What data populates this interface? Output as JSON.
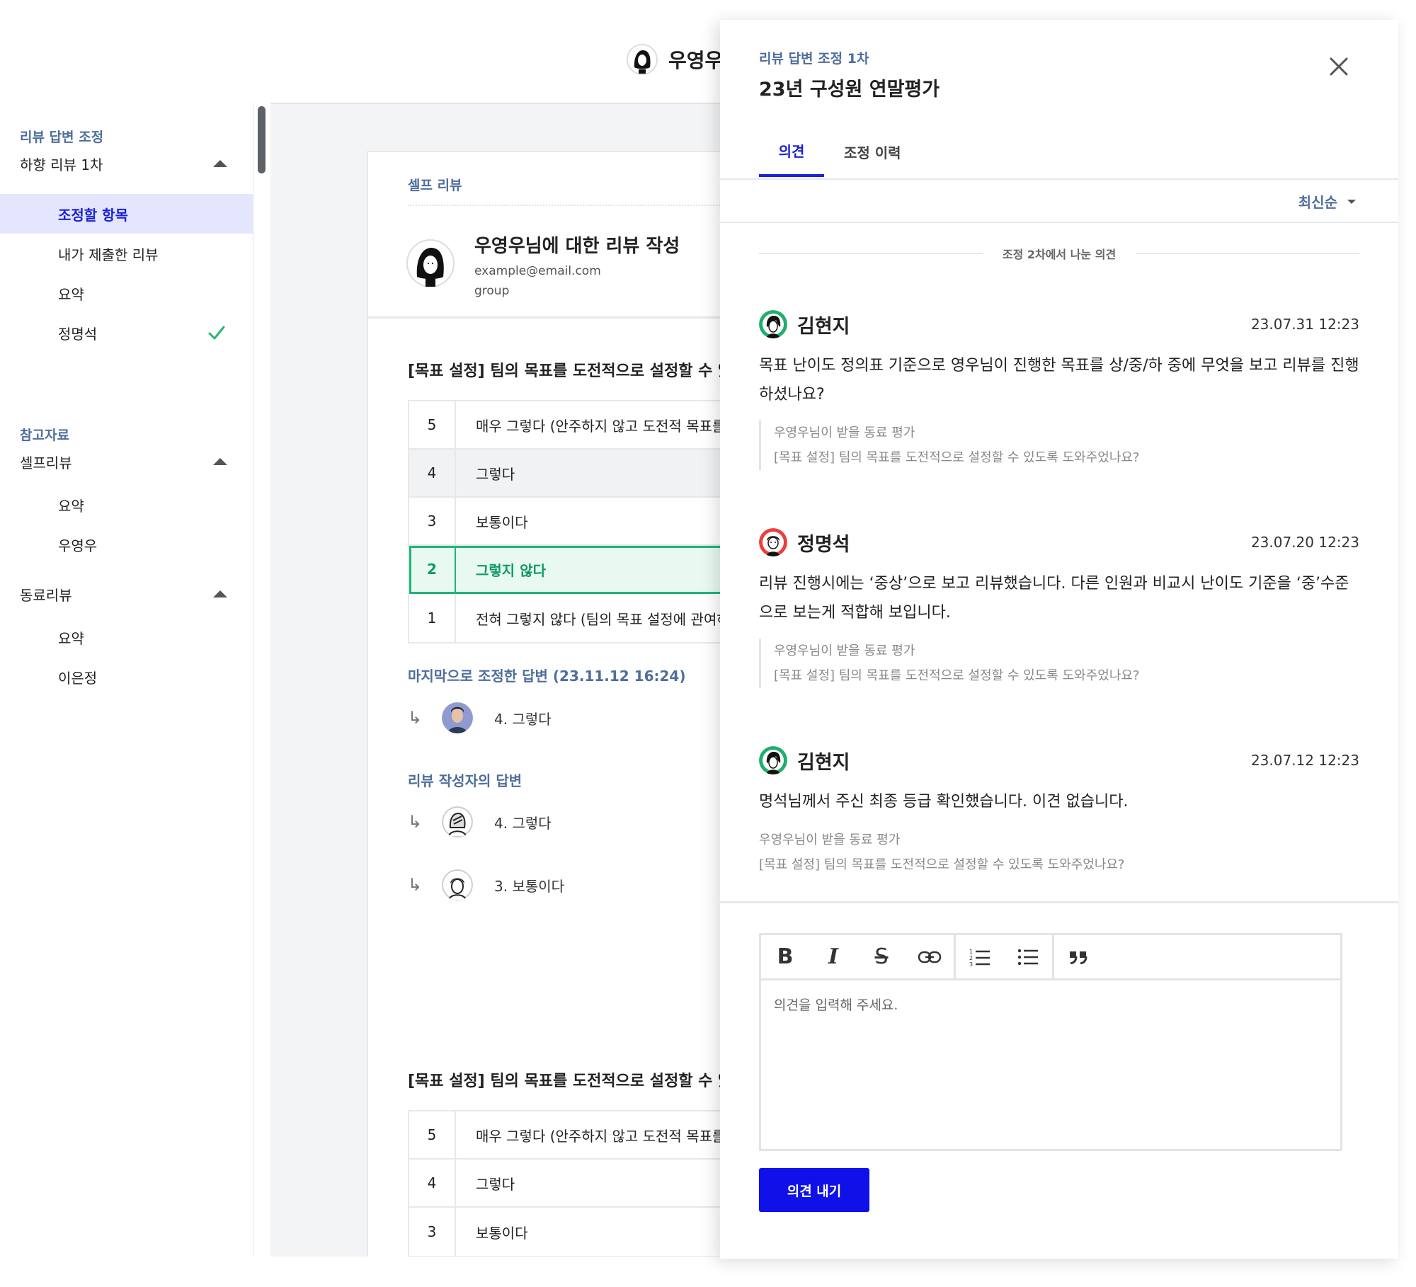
{
  "header": {
    "name": "우영우"
  },
  "sidebar": {
    "section_review": "리뷰 답변 조정",
    "group_down": "하향 리뷰 1차",
    "items_down": [
      {
        "label": "조정할 항목",
        "active": true
      },
      {
        "label": "내가 제출한 리뷰"
      },
      {
        "label": "요약"
      },
      {
        "label": "정명석",
        "done": true
      }
    ],
    "section_refs": "참고자료",
    "group_self": "셀프리뷰",
    "items_self": [
      {
        "label": "요약"
      },
      {
        "label": "우영우"
      }
    ],
    "group_peer": "동료리뷰",
    "items_peer": [
      {
        "label": "요약"
      },
      {
        "label": "이은정"
      }
    ]
  },
  "main": {
    "self_review_label": "셀프 리뷰",
    "profile": {
      "title": "우영우님에 대한 리뷰 작성",
      "email": "example@email.com",
      "group": "group"
    },
    "question1": "[목표 설정] 팀의 목표를 도전적으로 설정할 수 있",
    "scale1": [
      {
        "num": "5",
        "text": "매우 그렇다 (안주하지 않고 도전적 목표를 설"
      },
      {
        "num": "4",
        "text": "그렇다"
      },
      {
        "num": "3",
        "text": "보통이다"
      },
      {
        "num": "2",
        "text": "그렇지 않다"
      },
      {
        "num": "1",
        "text": "전혀 그렇지 않다 (팀의 목표 설정에 관여하지"
      }
    ],
    "last_adjusted_label": "마지막으로 조정한 답변 (23.11.12 16:24)",
    "last_adjusted_answer": "4. 그렇다",
    "author_answer_label": "리뷰 작성자의 답변",
    "author_answers": [
      "4. 그렇다",
      "3. 보통이다"
    ],
    "question2": "[목표 설정] 팀의 목표를 도전적으로 설정할 수 있",
    "scale2": [
      {
        "num": "5",
        "text": "매우 그렇다 (안주하지 않고 도전적 목표를 설"
      },
      {
        "num": "4",
        "text": "그렇다"
      },
      {
        "num": "3",
        "text": "보통이다"
      }
    ]
  },
  "drawer": {
    "subtitle": "리뷰 답변 조정 1차",
    "title": "23년 구성원 연말평가",
    "tabs": [
      "의견",
      "조정 이력"
    ],
    "sort_label": "최신순",
    "round_divider": "조정 2차에서 나눈 의견",
    "comments": [
      {
        "author": "김현지",
        "time": "23.07.31 12:23",
        "body": "목표 난이도 정의표 기준으로 영우님이 진행한 목표를 상/중/하 중에 무엇을 보고 리뷰를 진행하셨나요?",
        "quote_line1": "우영우님이 받을 동료 평가",
        "quote_line2": "[목표 설정] 팀의 목표를 도전적으로 설정할 수 있도록 도와주었나요?"
      },
      {
        "author": "정명석",
        "time": "23.07.20 12:23",
        "body": "리뷰 진행시에는 ‘중상’으로 보고 리뷰했습니다. 다른 인원과 비교시 난이도 기준을 ‘중’수준으로 보는게 적합해 보입니다.",
        "quote_line1": "우영우님이 받을 동료 평가",
        "quote_line2": "[목표 설정] 팀의 목표를 도전적으로 설정할 수 있도록 도와주었나요?"
      },
      {
        "author": "김현지",
        "time": "23.07.12 12:23",
        "body": "명석님께서 주신 최종 등급 확인했습니다. 이견 없습니다.",
        "quote_line1": "우영우님이 받을 동료 평가",
        "quote_line2": "[목표 설정] 팀의 목표를 도전적으로 설정할 수 있도록 도와주었나요?"
      }
    ],
    "editor_placeholder": "의견을 입력해 주세요.",
    "submit_label": "의견 내기"
  },
  "colors": {
    "accent": "#1a21d6",
    "label": "#4f6e9c",
    "selected": "#1fb57a",
    "button": "#1010e8"
  }
}
